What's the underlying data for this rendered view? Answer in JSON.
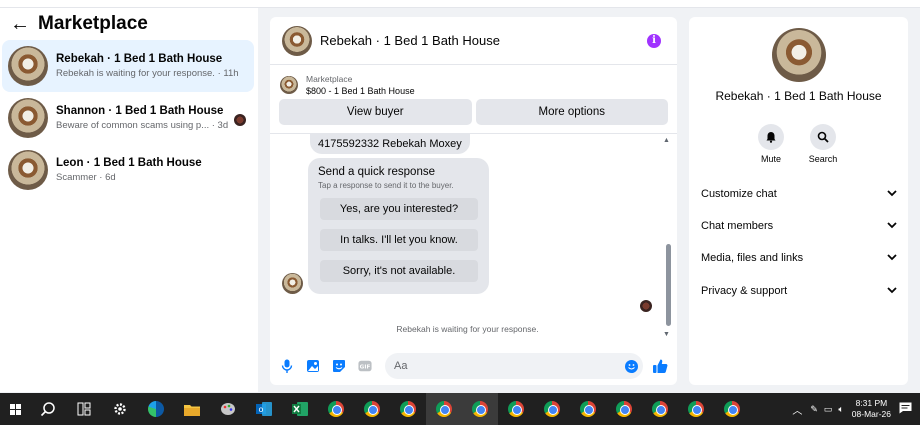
{
  "left": {
    "title": "Marketplace",
    "conversations": [
      {
        "title": "Rebekah · 1 Bed 1 Bath House",
        "subtitle": "Rebekah is waiting for your response. · 11h"
      },
      {
        "title": "Shannon · 1 Bed 1 Bath House",
        "subtitle": "Beware of common scams using p... · 3d"
      },
      {
        "title": "Leon · 1 Bed 1 Bath House",
        "subtitle": "Scammer · 6d"
      }
    ]
  },
  "chat": {
    "title": "Rebekah · 1 Bed 1 Bath House",
    "listing": {
      "category": "Marketplace",
      "price_title": "$800 - 1 Bed 1 Bath House"
    },
    "buttons": {
      "view_buyer": "View buyer",
      "more_options": "More options"
    },
    "message_text": "4175592332 Rebekah Moxey",
    "quick_response": {
      "title": "Send a quick response",
      "subtitle": "Tap a response to send it to the buyer.",
      "options": [
        "Yes, are you interested?",
        "In talks. I'll let you know.",
        "Sorry, it's not available."
      ]
    },
    "status": "Rebekah is waiting for your response.",
    "composer_placeholder": "Aa",
    "gif_label": "GIF"
  },
  "right": {
    "title": "Rebekah · 1 Bed 1 Bath House",
    "actions": {
      "mute": "Mute",
      "search": "Search"
    },
    "sections": [
      "Customize chat",
      "Chat members",
      "Media, files and links",
      "Privacy & support"
    ]
  },
  "taskbar": {
    "time": "8:31 PM",
    "date": "08-Mar-26"
  },
  "colors": {
    "accent": "#0a7cff",
    "info": "#a033ff",
    "active_row": "#e7f3ff"
  }
}
